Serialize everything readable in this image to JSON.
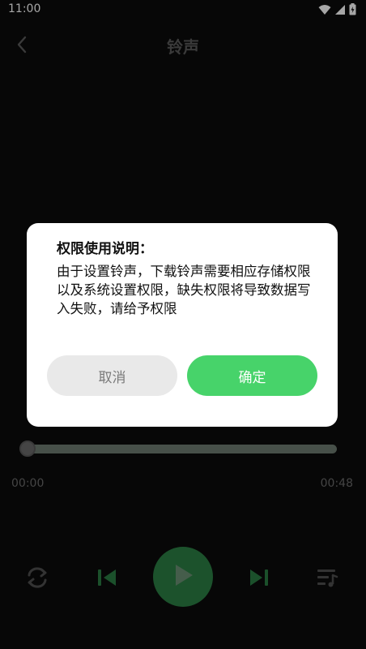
{
  "status_bar": {
    "time": "11:00",
    "icons": [
      "wifi-icon",
      "signal-icon",
      "battery-icon"
    ]
  },
  "header": {
    "title": "铃声",
    "back_icon": "chevron-left-icon"
  },
  "dialog": {
    "title": "权限使用说明：",
    "body": "由于设置铃声，下载铃声需要相应存储权限以及系统设置权限，缺失权限将导致数据写入失败，请给予权限",
    "cancel_label": "取消",
    "confirm_label": "确定"
  },
  "player": {
    "current_time": "00:00",
    "total_time": "00:48",
    "progress": 0.0,
    "controls": [
      "repeat-icon",
      "previous-icon",
      "play-icon",
      "next-icon",
      "playlist-icon"
    ]
  },
  "colors": {
    "accent": "#47d36a",
    "accent_dark": "#2c7e44",
    "background": "#0b0b0b",
    "dialog_bg": "#ffffff",
    "cancel_bg": "#e9e9e9"
  }
}
